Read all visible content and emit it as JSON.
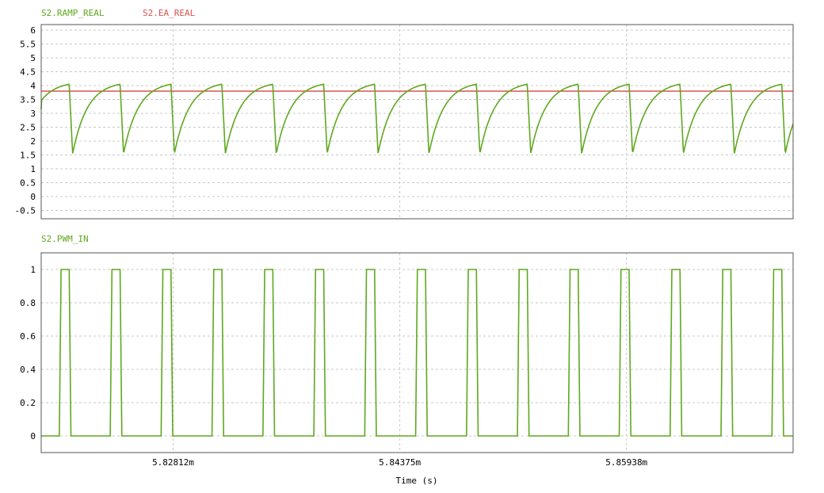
{
  "chart_data": [
    {
      "type": "line",
      "ylim": [
        -0.8,
        6.2
      ],
      "yticks": [
        6,
        5.5,
        5,
        4.5,
        4,
        3.5,
        3,
        2.5,
        2,
        1.5,
        1,
        0.5,
        0,
        -0.5
      ],
      "ytick_labels": [
        "6",
        "5.5",
        "5",
        "4.5",
        "4",
        "3.5",
        "3",
        "2.5",
        "2",
        "1.5",
        "1",
        "0.5",
        "0",
        "-0.5"
      ],
      "grid": true,
      "legend_position": "top-left",
      "series": [
        {
          "name": "S2.RAMP_REAL",
          "color": "#5fa81f",
          "waveform": "sawtooth",
          "min": 1.55,
          "max": 4.05,
          "start_value": 3.15
        },
        {
          "name": "S2.EA_REAL",
          "color": "#d9534f",
          "waveform": "constant",
          "value": 3.8
        }
      ]
    },
    {
      "type": "line",
      "ylim": [
        -0.1,
        1.1
      ],
      "yticks": [
        1,
        0.8,
        0.6,
        0.4,
        0.2,
        0
      ],
      "ytick_labels": [
        "1",
        "0.8",
        "0.6",
        "0.4",
        "0.2",
        "0"
      ],
      "grid": true,
      "legend_position": "top-left",
      "series": [
        {
          "name": "S2.PWM_IN",
          "color": "#5fa81f",
          "waveform": "pulse",
          "low": 0,
          "high": 1
        }
      ]
    }
  ],
  "x_axis": {
    "xlabel": "Time (s)",
    "xlim": [
      5.81902,
      5.87087
    ],
    "xticks": [
      5.82812,
      5.84375,
      5.85938
    ],
    "xtick_labels": [
      "5.82812m",
      "5.84375m",
      "5.85938m"
    ],
    "units": "ms",
    "period": 0.00351,
    "pulse_starts": [
      5.82027,
      5.82378,
      5.82729,
      5.8308,
      5.83431,
      5.83782,
      5.84133,
      5.84484,
      5.84835,
      5.85186,
      5.85537,
      5.85888,
      5.86239,
      5.8659,
      5.86941
    ],
    "pulse_width": 0.00068
  }
}
